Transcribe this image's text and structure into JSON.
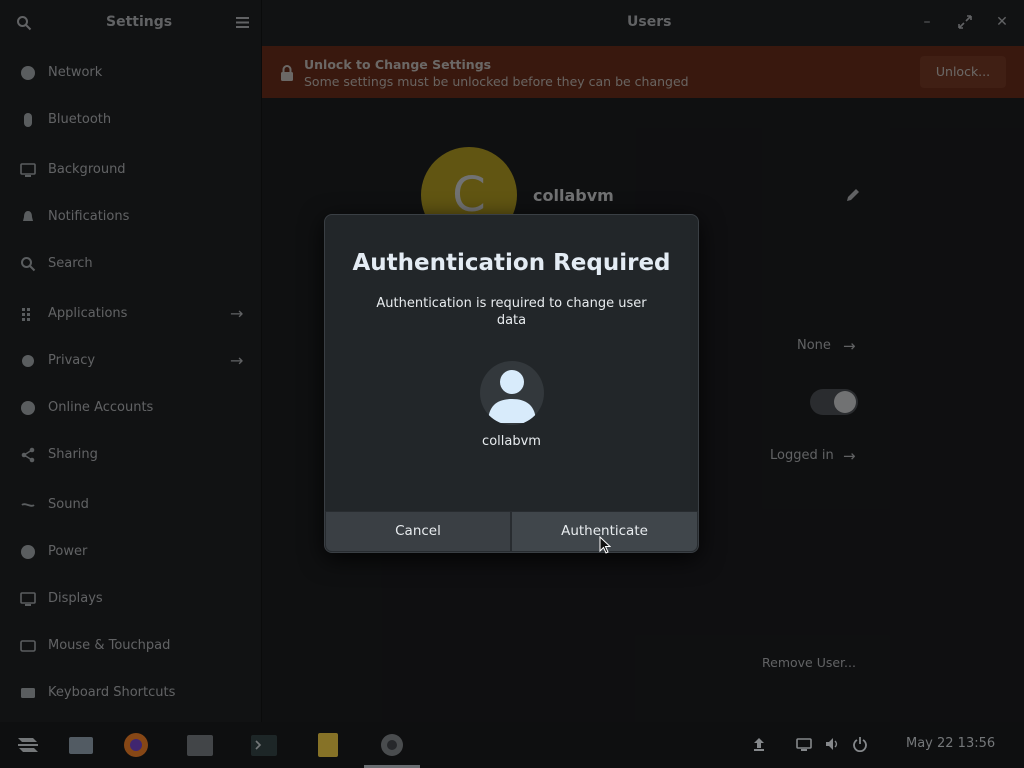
{
  "window": {
    "sidebar_title": "Settings",
    "main_title": "Users"
  },
  "sidebar": {
    "items": [
      {
        "label": "Network",
        "icon": "network-icon",
        "arrow": false
      },
      {
        "label": "Bluetooth",
        "icon": "bluetooth-icon",
        "arrow": false
      },
      {
        "label": "Background",
        "icon": "background-icon",
        "arrow": false
      },
      {
        "label": "Notifications",
        "icon": "notifications-icon",
        "arrow": false
      },
      {
        "label": "Search",
        "icon": "search-icon",
        "arrow": false
      },
      {
        "label": "Applications",
        "icon": "applications-icon",
        "arrow": true
      },
      {
        "label": "Privacy",
        "icon": "privacy-icon",
        "arrow": true
      },
      {
        "label": "Online Accounts",
        "icon": "online-accounts-icon",
        "arrow": false
      },
      {
        "label": "Sharing",
        "icon": "sharing-icon",
        "arrow": false
      },
      {
        "label": "Sound",
        "icon": "sound-icon",
        "arrow": false
      },
      {
        "label": "Power",
        "icon": "power-icon",
        "arrow": false
      },
      {
        "label": "Displays",
        "icon": "displays-icon",
        "arrow": false
      },
      {
        "label": "Mouse & Touchpad",
        "icon": "mouse-icon",
        "arrow": false
      },
      {
        "label": "Keyboard Shortcuts",
        "icon": "keyboard-icon",
        "arrow": false
      }
    ]
  },
  "infobar": {
    "title": "Unlock to Change Settings",
    "subtitle": "Some settings must be unlocked before they can be changed",
    "unlock_label": "Unlock..."
  },
  "user": {
    "initial": "C",
    "name": "collabvm",
    "password_value": "None",
    "history_value": "Logged in",
    "remove_label": "Remove User..."
  },
  "dialog": {
    "title": "Authentication Required",
    "message": "Authentication is required to change user data",
    "username": "collabvm",
    "cancel_label": "Cancel",
    "authenticate_label": "Authenticate"
  },
  "taskbar": {
    "apps": [
      "zorin-menu-icon",
      "files-icon",
      "firefox-icon",
      "file-manager-icon",
      "terminal-icon",
      "notes-icon",
      "settings-icon"
    ],
    "tray": [
      "upload-icon",
      "display-icon",
      "volume-icon",
      "power-icon"
    ],
    "clock": "May 22  13:56"
  },
  "colors": {
    "accent_avatar": "#d7ba1b",
    "infobar": "#7a2a10",
    "dialog_bg": "#222629"
  }
}
